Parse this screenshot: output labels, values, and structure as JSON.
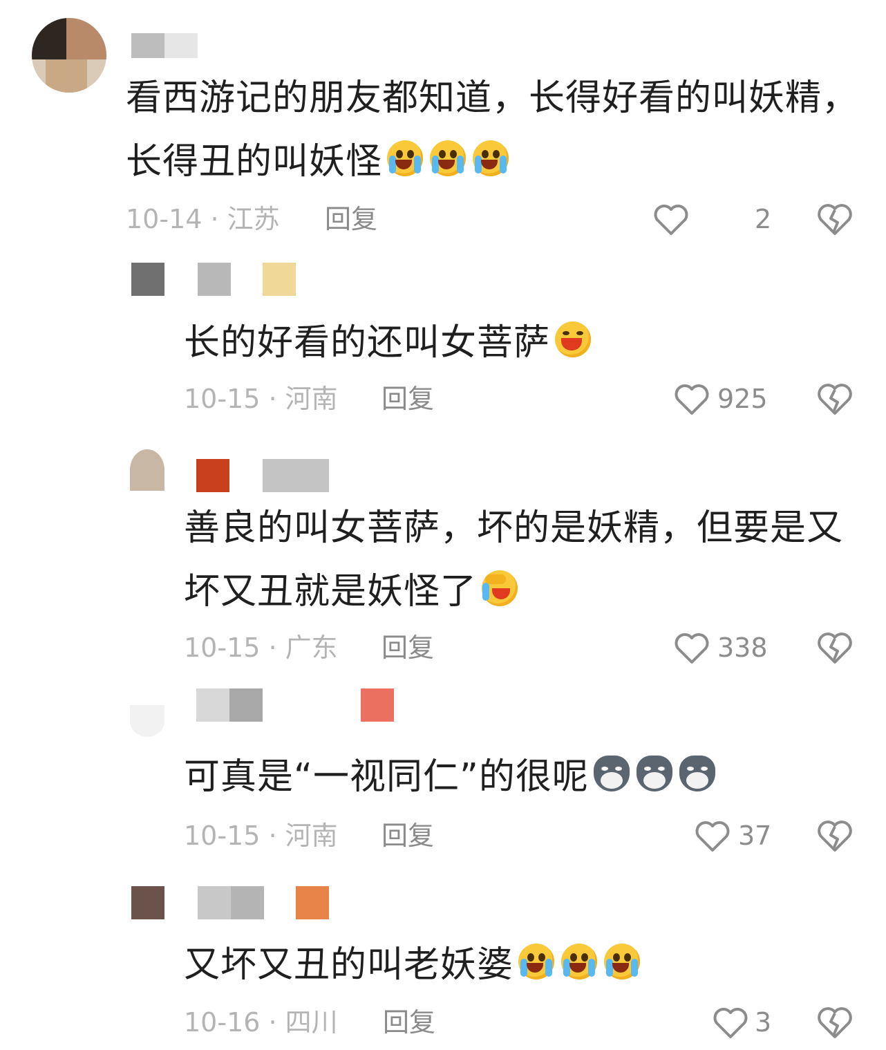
{
  "comments": [
    {
      "text": "看西游记的朋友都知道，长得好看的叫妖精，长得丑的叫妖怪",
      "date": "10-14 · 江苏",
      "reply": "回复",
      "likes": "2",
      "emojis": [
        "crying-laugh-icon",
        "crying-laugh-icon",
        "crying-laugh-icon"
      ]
    },
    {
      "text": "长的好看的还叫女菩萨",
      "date": "10-15 · 河南",
      "reply": "回复",
      "likes": "925",
      "emojis": [
        "laughing-icon"
      ]
    },
    {
      "text": "善良的叫女菩萨，坏的是妖精，但要是又坏又丑就是妖怪了",
      "date": "10-15 · 广东",
      "reply": "回复",
      "likes": "338",
      "emojis": [
        "facepalm-laugh-icon"
      ]
    },
    {
      "text": "可真是“一视同仁”的很呢",
      "date": "10-15 · 河南",
      "reply": "回复",
      "likes": "37",
      "emojis": [
        "wolf-icon",
        "wolf-icon",
        "wolf-icon"
      ]
    },
    {
      "text": "又坏又丑的叫老妖婆",
      "date": "10-16 · 四川",
      "reply": "回复",
      "likes": "3",
      "emojis": [
        "crying-laugh-icon",
        "crying-laugh-icon",
        "crying-laugh-icon"
      ]
    }
  ],
  "colors": {
    "like_icon": "#8c8c8c",
    "meta_text": "#b4b4b4",
    "reply_text": "#8a8a8a",
    "emoji_yellow": "#f9c93a"
  }
}
